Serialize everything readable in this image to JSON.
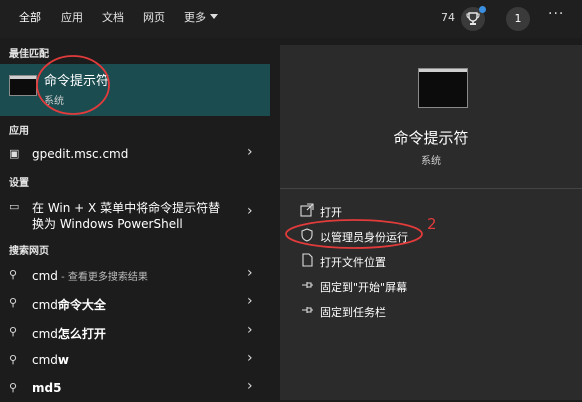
{
  "topbar": {
    "tabs": [
      {
        "label": "全部",
        "active": true
      },
      {
        "label": "应用"
      },
      {
        "label": "文档"
      },
      {
        "label": "网页"
      },
      {
        "label": "更多"
      }
    ],
    "points": "74",
    "account_number": "1",
    "more_label": "···"
  },
  "left": {
    "best_match_header": "最佳匹配",
    "best_match": {
      "title": "命令提示符",
      "subtitle": "系统"
    },
    "apps_header": "应用",
    "apps": [
      {
        "label": "gpedit.msc.cmd"
      }
    ],
    "settings_header": "设置",
    "settings": [
      {
        "line1": "在 Win + X 菜单中将命令提示符替",
        "line2": "换为 Windows PowerShell"
      }
    ],
    "web_header": "搜索网页",
    "web": [
      {
        "bold": "",
        "text": "cmd",
        "suffix": " - 查看更多搜索结果"
      },
      {
        "bold": "命令大全",
        "text": "cmd",
        "suffix": ""
      },
      {
        "bold": "怎么打开",
        "text": "cmd",
        "suffix": ""
      },
      {
        "bold": "w",
        "text": "cmd",
        "suffix": ""
      },
      {
        "bold": "5",
        "text": "md",
        "suffix": ""
      }
    ]
  },
  "right": {
    "title": "命令提示符",
    "subtitle": "系统",
    "actions": [
      {
        "label": "打开",
        "icon": "open-icon"
      },
      {
        "label": "以管理员身份运行",
        "icon": "shield-icon"
      },
      {
        "label": "打开文件位置",
        "icon": "file-location-icon"
      },
      {
        "label": "固定到\"开始\"屏幕",
        "icon": "pin-icon"
      },
      {
        "label": "固定到任务栏",
        "icon": "pin-icon"
      }
    ]
  },
  "annotation": {
    "number": "2",
    "color": "#e23b3b"
  }
}
